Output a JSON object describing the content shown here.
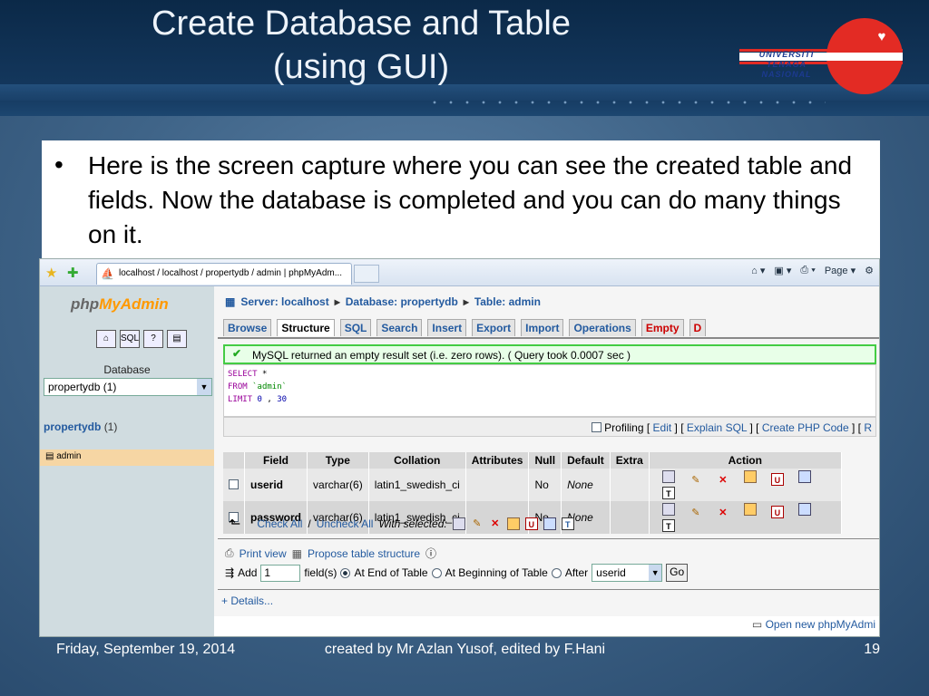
{
  "slide": {
    "title_line1": "Create Database and Table",
    "title_line2": "(using GUI)",
    "logo_line1": "UNIVERSITI",
    "logo_line2": "TENAGA",
    "logo_line3": "NASIONAL",
    "bullet": "Here is the screen capture where you can see the created table and fields. Now the database is completed and you can do many things on it.",
    "footer_date": "Friday, September 19, 2014",
    "footer_credit": "created by Mr Azlan Yusof, edited by F.Hani",
    "page_number": "19"
  },
  "browser": {
    "tab_title": "localhost / localhost / propertydb / admin | phpMyAdm...",
    "page_menu": "Page"
  },
  "left": {
    "logo_php": "php",
    "logo_my": "MyAdmin",
    "db_label": "Database",
    "db_select": "propertydb (1)",
    "db_link": "propertydb",
    "db_count": "(1)",
    "table_item": "admin"
  },
  "breadcrumb": {
    "server": "Server: localhost",
    "database": "Database: propertydb",
    "table": "Table: admin"
  },
  "tabs": [
    "Browse",
    "Structure",
    "SQL",
    "Search",
    "Insert",
    "Export",
    "Import",
    "Operations",
    "Empty",
    "D"
  ],
  "message": "MySQL returned an empty result set (i.e. zero rows). ( Query took 0.0007 sec )",
  "sql": {
    "select": "SELECT",
    "star": "*",
    "from": "FROM",
    "table": "`admin`",
    "limit": "LIMIT",
    "n1": "0",
    "comma": ",",
    "n2": "30"
  },
  "sql_links": {
    "profiling": "Profiling",
    "edit": "Edit",
    "explain": "Explain SQL",
    "create_php": "Create PHP Code",
    "refresh": "R"
  },
  "table": {
    "headers": [
      "Field",
      "Type",
      "Collation",
      "Attributes",
      "Null",
      "Default",
      "Extra",
      "Action"
    ],
    "rows": [
      {
        "field": "userid",
        "type": "varchar(6)",
        "collation": "latin1_swedish_ci",
        "attributes": "",
        "null": "No",
        "default": "None",
        "extra": ""
      },
      {
        "field": "password",
        "type": "varchar(6)",
        "collation": "latin1_swedish_ci",
        "attributes": "",
        "null": "No",
        "default": "None",
        "extra": ""
      }
    ]
  },
  "bulk": {
    "check_all": "Check All",
    "slash": "/",
    "uncheck_all": "Uncheck All",
    "with_selected": "With selected:"
  },
  "tools": {
    "print_view": "Print view",
    "propose": "Propose table structure",
    "add": "Add",
    "add_value": "1",
    "fields_label": "field(s)",
    "at_end": "At End of Table",
    "at_beginning": "At Beginning of Table",
    "after": "After",
    "after_value": "userid",
    "go": "Go",
    "details": "+ Details...",
    "open_new": "Open new phpMyAdmi"
  }
}
